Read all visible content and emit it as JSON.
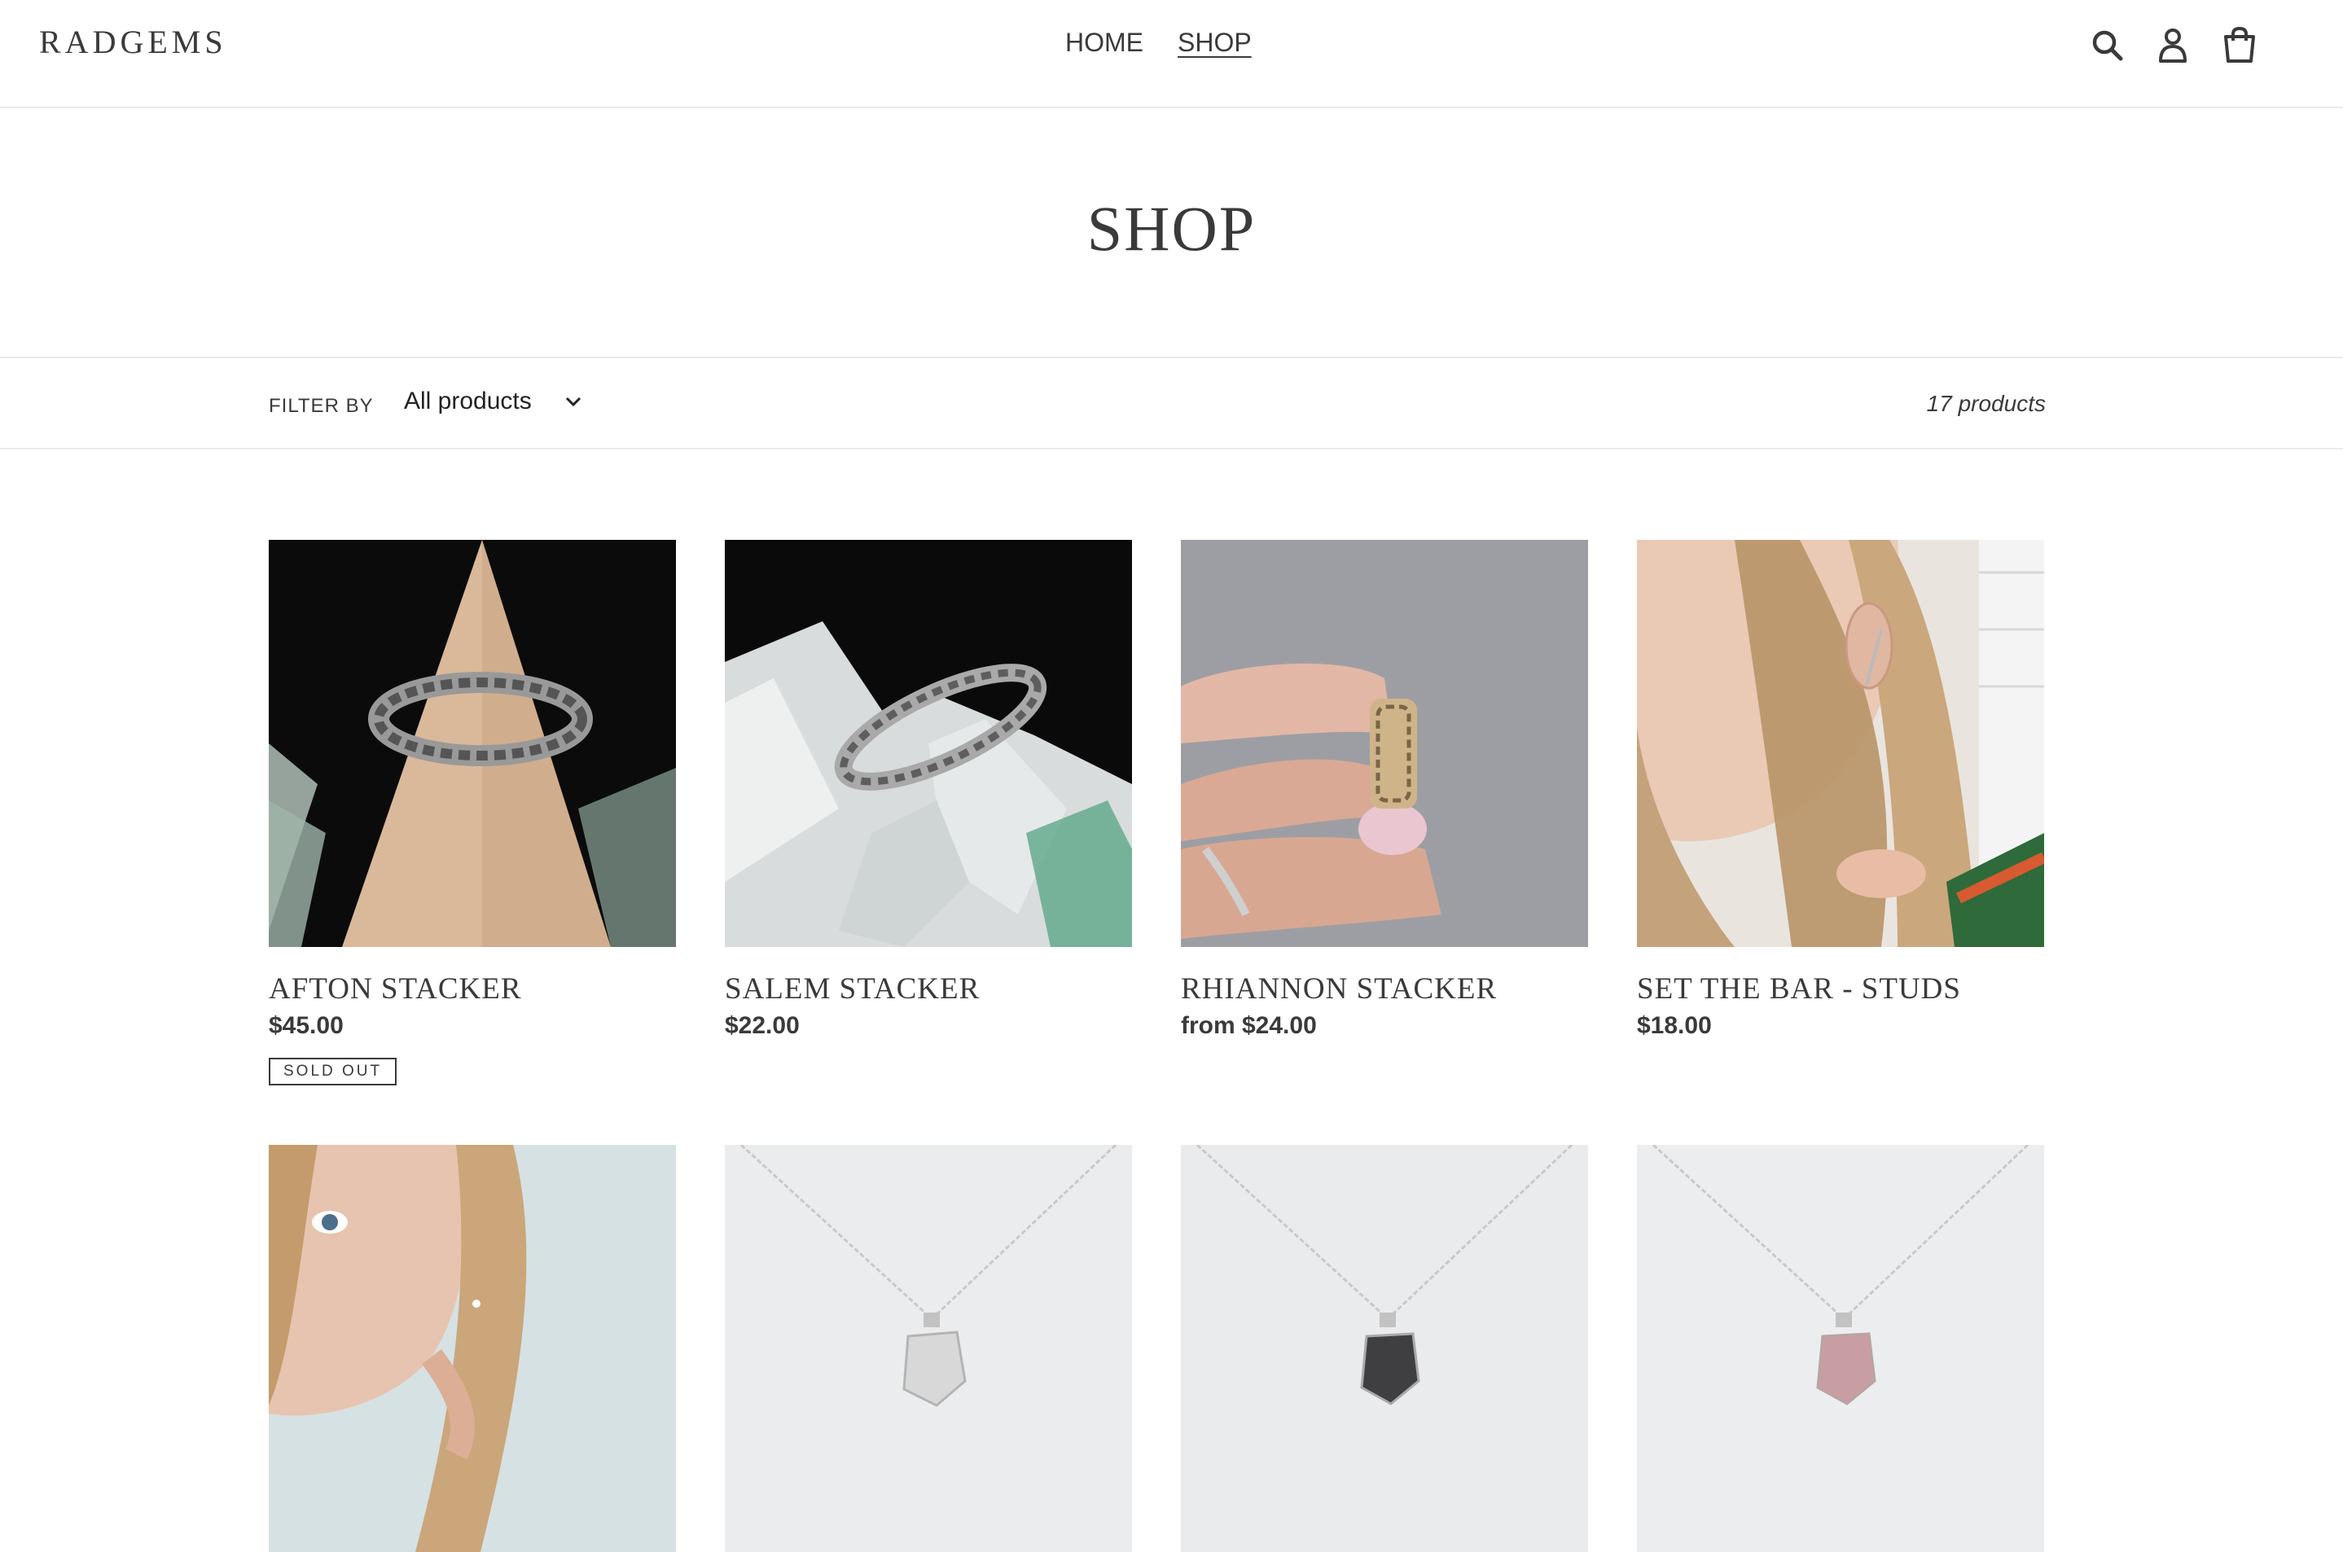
{
  "brand": {
    "logo": "RADGEMS"
  },
  "nav": {
    "home": "HOME",
    "shop": "SHOP"
  },
  "header_icons": [
    "search-icon",
    "account-icon",
    "cart-icon"
  ],
  "page": {
    "title": "SHOP"
  },
  "filter": {
    "label": "FILTER BY",
    "selected": "All products",
    "count": "17 products"
  },
  "products": [
    {
      "name": "AFTON STACKER",
      "price": "$45.00",
      "badge": "SOLD OUT"
    },
    {
      "name": "SALEM STACKER",
      "price": "$22.00"
    },
    {
      "name": "RHIANNON STACKER",
      "price": "from $24.00"
    },
    {
      "name": "SET THE BAR - STUDS",
      "price": "$18.00"
    }
  ],
  "colors": {
    "text": "#3a3a3a",
    "border": "#e8e9eb",
    "background": "#ffffff"
  }
}
